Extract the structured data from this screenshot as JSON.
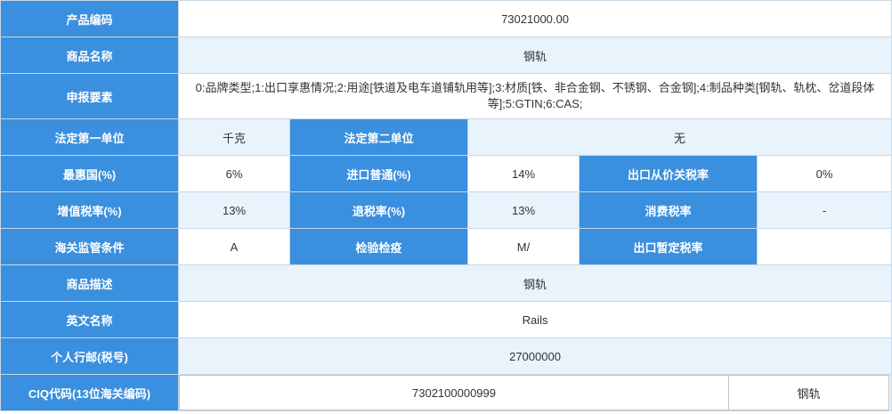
{
  "rows": {
    "product_code": {
      "label": "产品编码",
      "value": "73021000.00"
    },
    "product_name": {
      "label": "商品名称",
      "value": "钢轨"
    },
    "declaration": {
      "label": "申报要素",
      "value": "0:品牌类型;1:出口享惠情况;2:用途[铁道及电车道铺轨用等];3:材质[铁、非合金钢、不锈钢、合金钢];4:制品种类[钢轨、轨枕、岔道段体等];5:GTIN;6:CAS;"
    },
    "unit1": {
      "label": "法定第一单位",
      "value": "千克"
    },
    "unit2": {
      "label": "法定第二单位",
      "value": "无"
    },
    "mfn": {
      "label": "最惠国(%)",
      "value": "6%"
    },
    "import_general": {
      "label": "进口普通(%)",
      "value": "14%"
    },
    "export_ad_valorem": {
      "label": "出口从价关税率",
      "value": "0%"
    },
    "vat": {
      "label": "增值税率(%)",
      "value": "13%"
    },
    "refund": {
      "label": "退税率(%)",
      "value": "13%"
    },
    "consumption": {
      "label": "消费税率",
      "value": "-"
    },
    "customs_cond": {
      "label": "海关监管条件",
      "value": "A"
    },
    "inspection": {
      "label": "检验检疫",
      "value": "M/"
    },
    "export_provisional": {
      "label": "出口暂定税率",
      "value": ""
    },
    "description": {
      "label": "商品描述",
      "value": "钢轨"
    },
    "english_name": {
      "label": "英文名称",
      "value": "Rails"
    },
    "postal": {
      "label": "个人行邮(税号)",
      "value": "27000000"
    },
    "ciq": {
      "label": "CIQ代码(13位海关编码)",
      "code": "7302100000999",
      "name": "钢轨"
    }
  }
}
